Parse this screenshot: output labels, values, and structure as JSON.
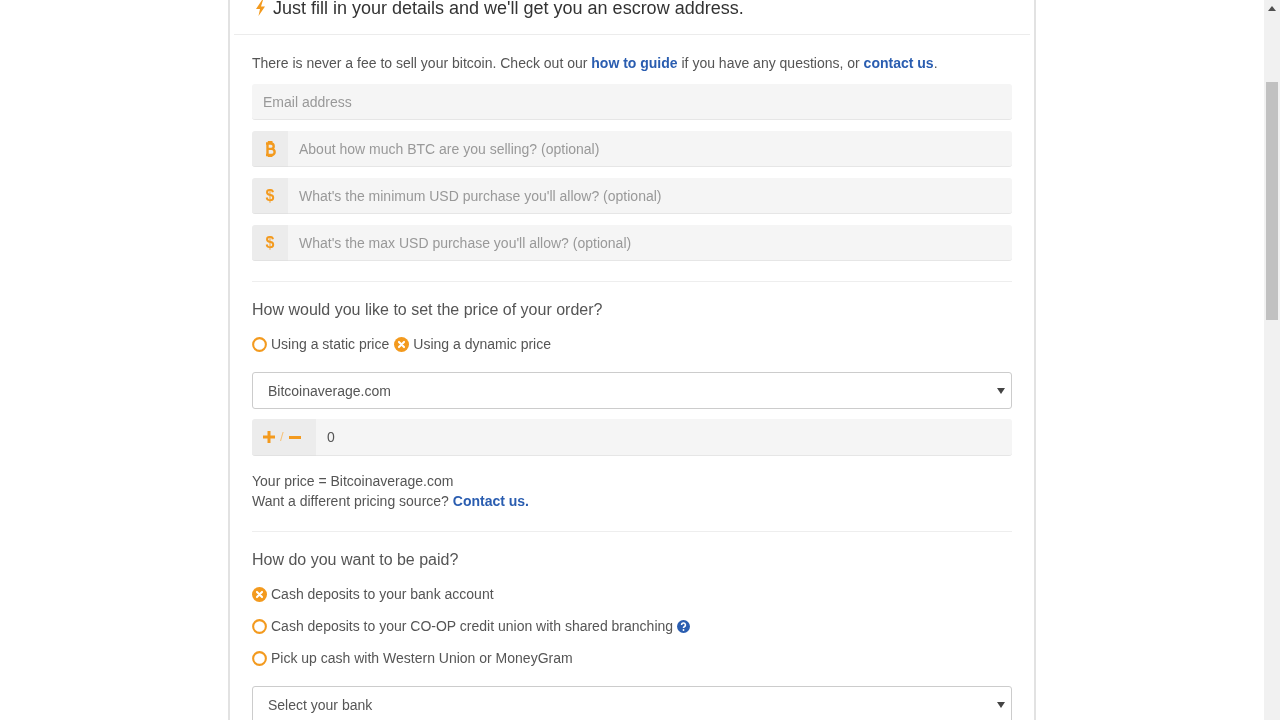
{
  "header": {
    "title": "Just fill in your details and we'll get you an escrow address."
  },
  "intro": [
    {
      "kind": "text",
      "text": "There is never a fee to sell your bitcoin. Check out our "
    },
    {
      "kind": "link",
      "text": "how to guide"
    },
    {
      "kind": "text",
      "text": " if you have any questions, or "
    },
    {
      "kind": "link",
      "text": "contact us"
    },
    {
      "kind": "text",
      "text": "."
    }
  ],
  "fields": [
    {
      "kind": "plain",
      "placeholder": "Email address"
    },
    {
      "kind": "bitcoin",
      "placeholder": "About how much BTC are you selling? (optional)"
    },
    {
      "kind": "symbol",
      "symbol": "$",
      "placeholder": "What's the minimum USD purchase you'll allow? (optional)"
    },
    {
      "kind": "symbol",
      "symbol": "$",
      "placeholder": "What's the max USD purchase you'll allow? (optional)"
    }
  ],
  "pricing": {
    "heading": "How would you like to set the price of your order?",
    "options": [
      {
        "label": "Using a static price",
        "selected": false
      },
      {
        "label": "Using a dynamic price",
        "selected": true
      }
    ],
    "source": {
      "value": "Bitcoinaverage.com"
    },
    "adjustment": {
      "separator": "/",
      "value": "0"
    },
    "notes": [
      {
        "parts": [
          {
            "kind": "text",
            "text": "Your price = Bitcoinaverage.com"
          }
        ]
      },
      {
        "parts": [
          {
            "kind": "text",
            "text": "Want a different pricing source? "
          },
          {
            "kind": "link",
            "text": "Contact us."
          }
        ]
      }
    ]
  },
  "payment": {
    "heading": "How do you want to be paid?",
    "options": [
      {
        "label": "Cash deposits to your bank account",
        "selected": true,
        "info": false
      },
      {
        "label": "Cash deposits to your CO-OP credit union with shared branching",
        "selected": false,
        "info": true
      },
      {
        "label": "Pick up cash with Western Union or MoneyGram",
        "selected": false,
        "info": false
      }
    ],
    "bank": {
      "value": "Select your bank"
    }
  }
}
